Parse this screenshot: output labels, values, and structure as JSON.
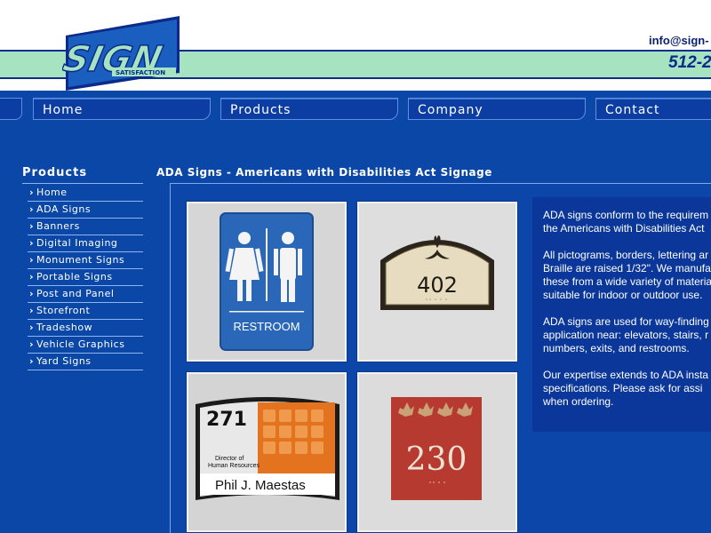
{
  "header": {
    "email": "info@sign-",
    "phone": "512-2",
    "logo_main": "SIGN",
    "logo_sub": "SATISFACTION"
  },
  "nav": {
    "items": [
      "Home",
      "Products",
      "Company",
      "Contact"
    ]
  },
  "sidebar": {
    "title": "Products",
    "items": [
      {
        "label": "Home"
      },
      {
        "label": "ADA Signs"
      },
      {
        "label": "Banners"
      },
      {
        "label": "Digital Imaging"
      },
      {
        "label": "Monument Signs"
      },
      {
        "label": "Portable Signs"
      },
      {
        "label": "Post and Panel"
      },
      {
        "label": "Storefront"
      },
      {
        "label": "Tradeshow"
      },
      {
        "label": "Vehicle Graphics"
      },
      {
        "label": "Yard Signs"
      }
    ]
  },
  "main": {
    "title": "ADA Signs - Americans with Disabilities Act Signage",
    "photos": [
      {
        "caption": "RESTROOM"
      },
      {
        "number": "402"
      },
      {
        "number": "271",
        "line1": "Director of",
        "line2": "Human Resources",
        "name": "Phil J. Maestas"
      },
      {
        "number": "230"
      }
    ],
    "paragraphs": [
      [
        "ADA signs conform to the requirem",
        "the Americans with Disabilities Act"
      ],
      [
        "All pictograms, borders, lettering ar",
        "Braille are raised 1/32\". We manufa",
        "these from a wide variety of materia",
        "suitable for indoor or outdoor use."
      ],
      [
        "ADA signs are used for way-finding",
        "application near: elevators, stairs, r",
        "numbers, exits, and restrooms."
      ],
      [
        "Our expertise extends to ADA insta",
        "specifications. Please ask for assi",
        "when ordering."
      ]
    ]
  },
  "colors": {
    "background": "#0a47a6",
    "header_band": "#a6e4c1",
    "text_box": "#0a3799"
  }
}
